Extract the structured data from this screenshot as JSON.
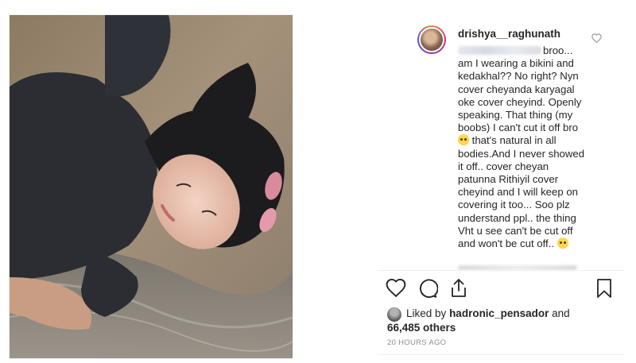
{
  "post": {
    "username": "drishya__raghunath",
    "comment_lines": [
      "broo...",
      "am I wearing a bikini and",
      "kedakhal?? No right? Nyn",
      "cover cheyanda karyagal",
      "oke cover cheyind. Openly",
      "speaking. That thing (my",
      "boobs) I can't cut it off bro",
      "that's natural in all",
      "bodies.And I never showed",
      "it off.. cover cheyan",
      "patunna Rithiyil cover",
      "cheyind and I will keep on",
      "covering it too... Soo plz",
      "understand ppl.. the thing",
      "Vht u see can't be cut off",
      "and won't be cut off.."
    ],
    "liked_by_prefix": "Liked by",
    "liked_by_user": "hadronic_pensador",
    "liked_by_and": "and",
    "likes_count": "66,485 others",
    "timestamp": "20 HOURS AGO"
  },
  "icons": {
    "comment_like": "heart-outline-icon",
    "like": "heart-outline-icon",
    "comment": "speech-bubble-icon",
    "share": "share-upload-icon",
    "save": "bookmark-icon",
    "emoji": "crying-laughing-emoji"
  },
  "colors": {
    "text": "#262626",
    "muted": "#8e8e8e",
    "divider": "#efefef",
    "story_ring": "#dd2a7b"
  }
}
